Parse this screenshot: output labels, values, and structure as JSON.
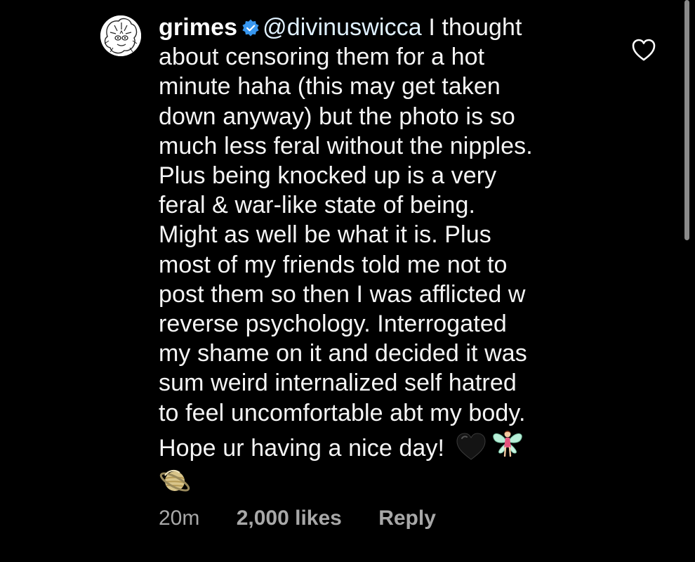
{
  "comment": {
    "username": "grimes",
    "verified": true,
    "mention": "@divinuswicca",
    "first_line_rest": " I thought",
    "lines": [
      "about censoring them for a hot",
      "minute haha (this may get taken",
      "down anyway) but the photo is so",
      "much less feral without the nipples.",
      "Plus being knocked up is a very",
      "feral & war-like state of being.",
      "Might as well be what it is.  Plus",
      "most of my friends told me not to",
      "post them so then I was afflicted w",
      "reverse psychology.  Interrogated",
      "my shame on it and decided it was",
      "sum weird internalized self hatred",
      "to feel uncomfortable abt my body."
    ],
    "last_line": "Hope ur having a nice day! ",
    "emojis": [
      "black-heart-emoji",
      "fairy-emoji",
      "ringed-planet-emoji"
    ]
  },
  "meta": {
    "time": "20m",
    "likes": "2,000 likes",
    "reply": "Reply"
  },
  "icons": {
    "like": "heart-outline-icon",
    "verified": "verified-badge-icon"
  },
  "colors": {
    "background": "#000000",
    "text": "#ffffff",
    "secondary": "#a8a8a8",
    "verified": "#3897f0"
  }
}
